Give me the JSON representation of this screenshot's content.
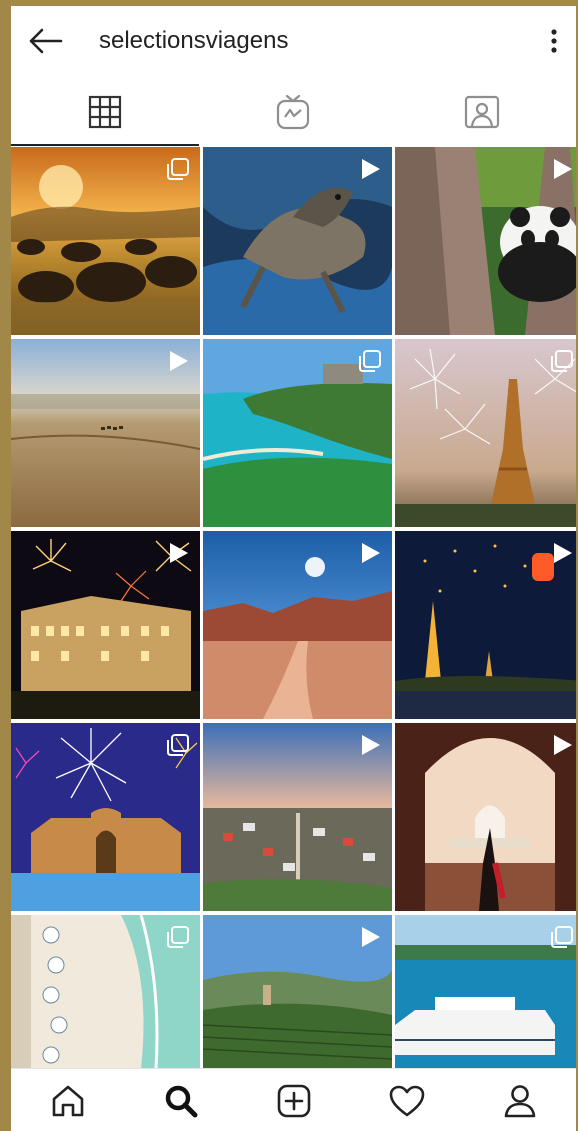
{
  "profile": {
    "username": "selectionsviagens"
  },
  "icons": {
    "back": "arrow-left-icon",
    "more": "more-vertical-icon",
    "tabs": [
      "grid-icon",
      "igtv-icon",
      "tagged-icon"
    ],
    "nav": [
      "home-icon",
      "search-icon",
      "add-post-icon",
      "heart-icon",
      "profile-icon"
    ]
  },
  "tabs": {
    "active_index": 0
  },
  "posts": [
    {
      "scene": "wildebeest-savanna-sunset",
      "type": "carousel"
    },
    {
      "scene": "iguana-on-rocks",
      "type": "video"
    },
    {
      "scene": "panda-in-tree",
      "type": "video"
    },
    {
      "scene": "desert-camel-caravan",
      "type": "video"
    },
    {
      "scene": "tulum-coast-ruins",
      "type": "carousel"
    },
    {
      "scene": "eiffel-tower-fireworks",
      "type": "carousel"
    },
    {
      "scene": "hotel-fireworks-night",
      "type": "video"
    },
    {
      "scene": "desert-road-moon",
      "type": "video"
    },
    {
      "scene": "thai-temple-lanterns",
      "type": "video"
    },
    {
      "scene": "mosque-fireworks",
      "type": "carousel"
    },
    {
      "scene": "reykjavik-aerial",
      "type": "video"
    },
    {
      "scene": "taj-mahal-woman",
      "type": "video"
    },
    {
      "scene": "beach-aerial-umbrellas",
      "type": "carousel"
    },
    {
      "scene": "vineyard-hills",
      "type": "video"
    },
    {
      "scene": "cruise-ship-lagoon",
      "type": "carousel"
    }
  ]
}
